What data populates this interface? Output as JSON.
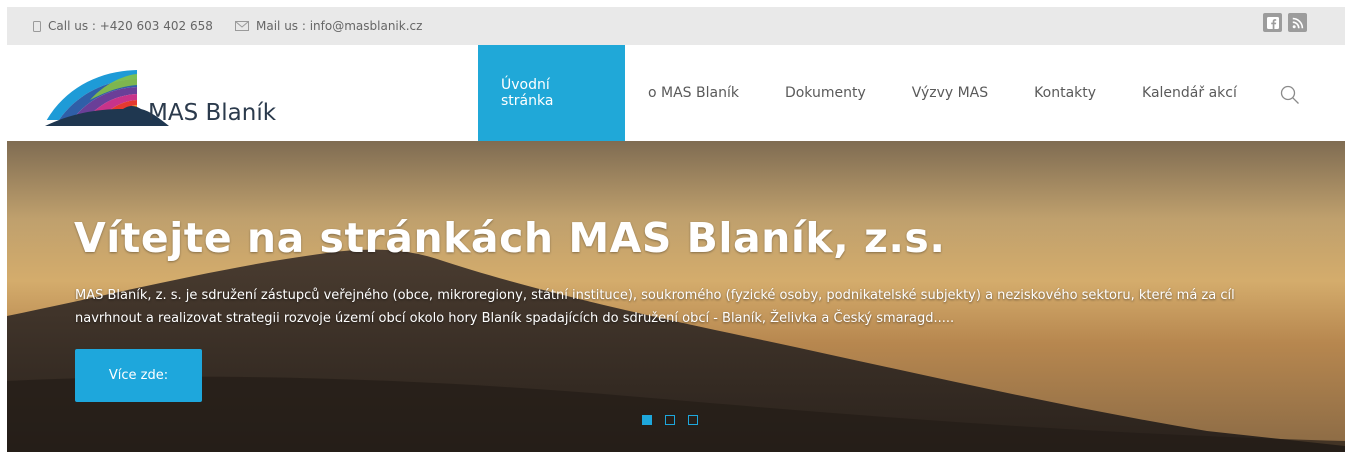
{
  "topbar": {
    "call": "Call us : +420 603 402 658",
    "mail": "Mail us : info@masblanik.cz",
    "social_icons": [
      "facebook-icon",
      "rss-icon"
    ]
  },
  "logo": {
    "text": "MAS Blaník"
  },
  "nav": {
    "items": [
      "Úvodní stránka",
      "o MAS Blaník",
      "Dokumenty",
      "Výzvy MAS",
      "Kontakty",
      "Kalendář akcí"
    ],
    "active_index": 0,
    "search_icon": "search-icon"
  },
  "hero": {
    "title": "Vítejte na stránkách MAS Blaník, z.s.",
    "description": "MAS Blaník, z. s. je sdružení zástupců veřejného (obce, mikroregiony, státní instituce), soukromého (fyzické osoby, podnikatelské subjekty) a neziskového sektoru, které má za cíl navrhnout a realizovat strategii rozvoje území obcí okolo hory Blaník spadajících do sdružení obcí - Blaník, Želivka a Český smaragd.....",
    "button": "Více zde:",
    "slides": 3,
    "active_slide": 0
  },
  "colors": {
    "accent": "#20a8d8",
    "topbar_bg": "#e9e9e9",
    "nav_text": "#5a5a5a"
  }
}
